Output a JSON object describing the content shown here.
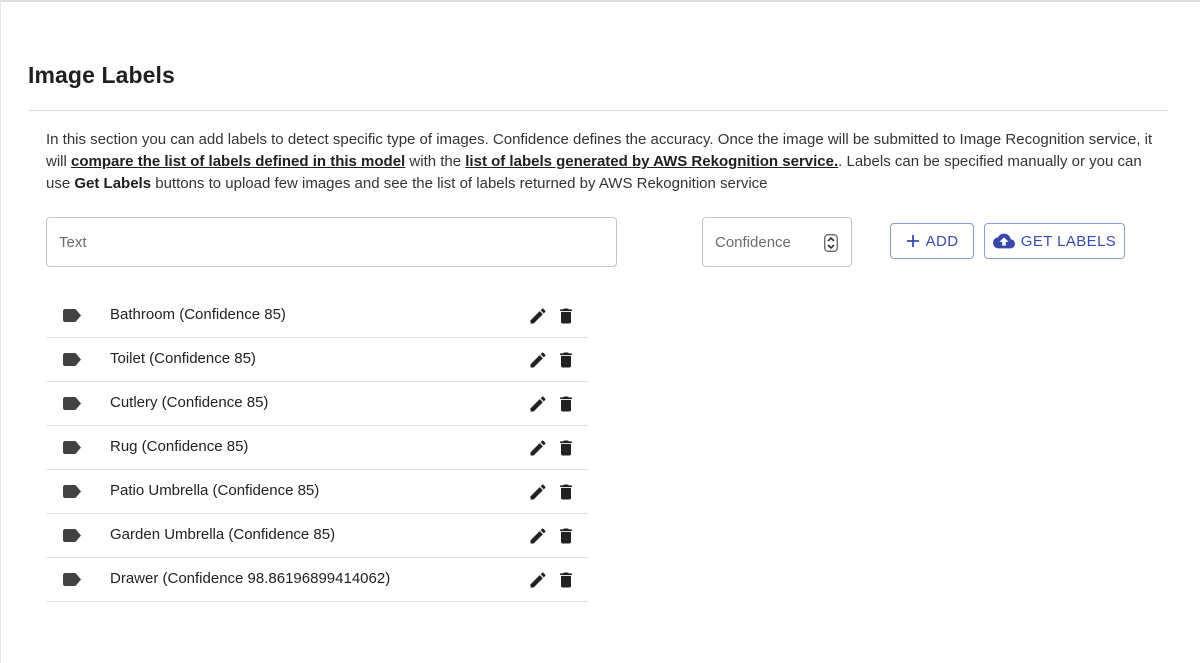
{
  "page": {
    "title": "Image Labels"
  },
  "description": {
    "part1": "In this section you can add labels to detect specific type of images. Confidence defines the accuracy. Once the image will be submitted to Image Recognition service, it will ",
    "link1": "compare the list of labels defined in this model",
    "part2": " with the ",
    "link2": "list of labels generated by AWS Rekognition service.",
    "part3": ". Labels can be specified manually or you can use ",
    "bold1": "Get Labels",
    "part4": " buttons to upload few images and see the list of labels returned by AWS Rekognition service"
  },
  "form": {
    "text_placeholder": "Text",
    "confidence_placeholder": "Confidence",
    "add_label": "ADD",
    "get_labels_label": "GET LABELS"
  },
  "labels": [
    {
      "text": "Bathroom (Confidence 85)"
    },
    {
      "text": "Toilet (Confidence 85)"
    },
    {
      "text": "Cutlery (Confidence 85)"
    },
    {
      "text": "Rug (Confidence 85)"
    },
    {
      "text": "Patio Umbrella (Confidence 85)"
    },
    {
      "text": "Garden Umbrella (Confidence 85)"
    },
    {
      "text": "Drawer (Confidence 98.86196899414062)"
    }
  ],
  "icons": {
    "tag": "label-tag-icon",
    "edit": "pencil-icon",
    "delete": "trash-icon",
    "add": "plus-icon",
    "get_labels": "cloud-upload-icon",
    "spinner": "spinner-arrows-icon"
  },
  "colors": {
    "accent": "#3949ab",
    "accent_border": "#8c9dd6",
    "icon": "#212121"
  }
}
